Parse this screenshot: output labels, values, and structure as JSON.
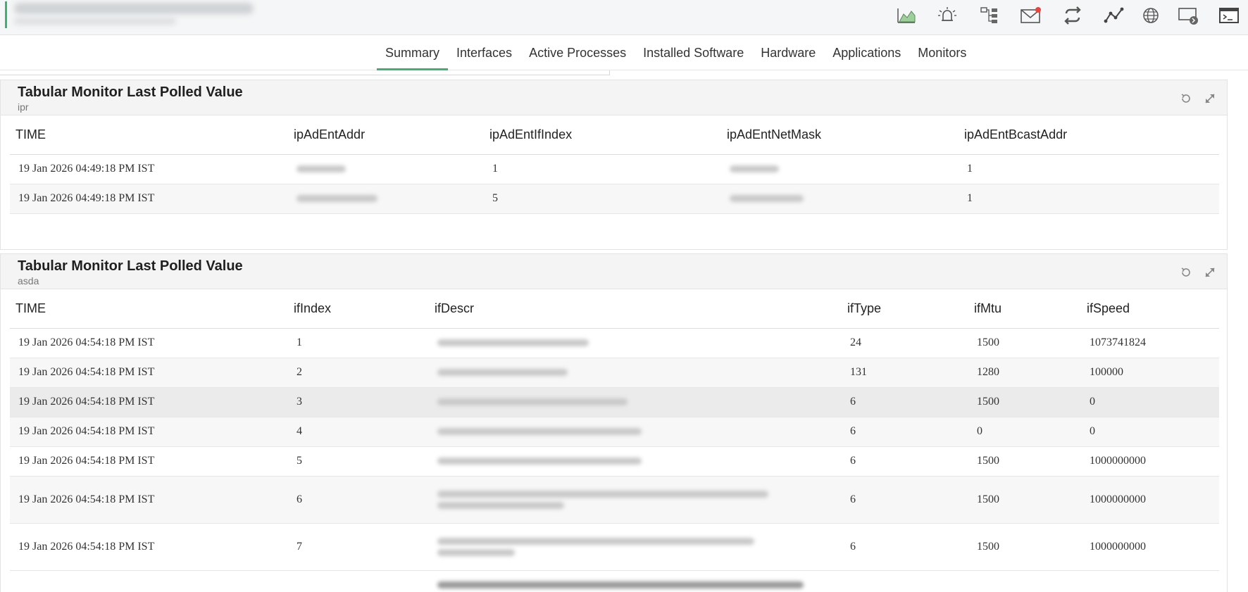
{
  "header": {
    "icons": [
      {
        "name": "graph-icon"
      },
      {
        "name": "alarm-icon"
      },
      {
        "name": "topology-icon"
      },
      {
        "name": "mail-icon",
        "badge": true,
        "badge_color": "#e8453c"
      },
      {
        "name": "sync-icon"
      },
      {
        "name": "trend-icon"
      },
      {
        "name": "globe-icon"
      },
      {
        "name": "remote-desktop-icon"
      },
      {
        "name": "terminal-icon"
      }
    ]
  },
  "tabs": [
    {
      "label": "Summary",
      "active": true
    },
    {
      "label": "Interfaces"
    },
    {
      "label": "Active Processes"
    },
    {
      "label": "Installed Software"
    },
    {
      "label": "Hardware"
    },
    {
      "label": "Applications"
    },
    {
      "label": "Monitors"
    }
  ],
  "panel1": {
    "title": "Tabular Monitor Last Polled Value",
    "subtitle": "ipr",
    "columns": [
      "TIME",
      "ipAdEntAddr",
      "ipAdEntIfIndex",
      "ipAdEntNetMask",
      "ipAdEntBcastAddr"
    ],
    "rows": [
      {
        "time": "19 Jan 2026 04:49:18 PM IST",
        "ifindex": "1",
        "bcast": "1"
      },
      {
        "time": "19 Jan 2026 04:49:18 PM IST",
        "ifindex": "5",
        "bcast": "1"
      }
    ]
  },
  "panel2": {
    "title": "Tabular Monitor Last Polled Value",
    "subtitle": "asda",
    "columns": [
      "TIME",
      "ifIndex",
      "ifDescr",
      "ifType",
      "ifMtu",
      "ifSpeed"
    ],
    "rows": [
      {
        "time": "19 Jan 2026 04:54:18 PM IST",
        "ifIndex": "1",
        "ifType": "24",
        "ifMtu": "1500",
        "ifSpeed": "1073741824"
      },
      {
        "time": "19 Jan 2026 04:54:18 PM IST",
        "ifIndex": "2",
        "ifType": "131",
        "ifMtu": "1280",
        "ifSpeed": "100000"
      },
      {
        "time": "19 Jan 2026 04:54:18 PM IST",
        "ifIndex": "3",
        "ifType": "6",
        "ifMtu": "1500",
        "ifSpeed": "0"
      },
      {
        "time": "19 Jan 2026 04:54:18 PM IST",
        "ifIndex": "4",
        "ifType": "6",
        "ifMtu": "0",
        "ifSpeed": "0"
      },
      {
        "time": "19 Jan 2026 04:54:18 PM IST",
        "ifIndex": "5",
        "ifType": "6",
        "ifMtu": "1500",
        "ifSpeed": "1000000000"
      },
      {
        "time": "19 Jan 2026 04:54:18 PM IST",
        "ifIndex": "6",
        "ifType": "6",
        "ifMtu": "1500",
        "ifSpeed": "1000000000"
      },
      {
        "time": "19 Jan 2026 04:54:18 PM IST",
        "ifIndex": "7",
        "ifType": "6",
        "ifMtu": "1500",
        "ifSpeed": "1000000000"
      }
    ]
  }
}
